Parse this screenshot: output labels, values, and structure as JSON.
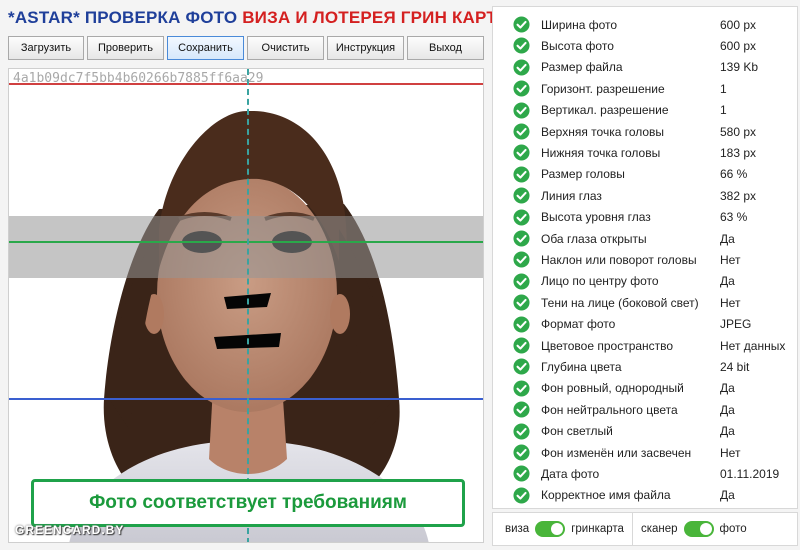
{
  "title": {
    "part1": "*ASTAR* ПРОВЕРКА ФОТО",
    "part2": "ВИЗА И ЛОТЕРЕЯ ГРИН КАРТА",
    "color1": "#1f3f9a",
    "color2": "#d42020"
  },
  "toolbar": {
    "buttons": [
      {
        "label": "Загрузить"
      },
      {
        "label": "Проверить"
      },
      {
        "label": "Сохранить"
      },
      {
        "label": "Очистить"
      },
      {
        "label": "Инструкция"
      },
      {
        "label": "Выход"
      }
    ]
  },
  "photo": {
    "hash": "4a1b09dc7f5bb4b60266b7885ff6aa29",
    "status_text": "Фото соответствует требованиям",
    "watermark": "GREENCARD.BY",
    "line_colors": {
      "top": "#d04040",
      "eyes": "#2aa84a",
      "bottom": "#3a5fd0",
      "center": "#3aa3a0"
    }
  },
  "checks": [
    {
      "label": "Ширина фото",
      "value": "600 px"
    },
    {
      "label": "Высота фото",
      "value": "600 px"
    },
    {
      "label": "Размер файла",
      "value": "139 Kb"
    },
    {
      "label": "Горизонт. разрешение",
      "value": "1"
    },
    {
      "label": "Вертикал. разрешение",
      "value": "1"
    },
    {
      "label": "Верхняя точка головы",
      "value": "580 px"
    },
    {
      "label": "Нижняя точка головы",
      "value": "183 px"
    },
    {
      "label": "Размер головы",
      "value": "66 %"
    },
    {
      "label": "Линия глаз",
      "value": "382 px"
    },
    {
      "label": "Высота уровня глаз",
      "value": "63 %"
    },
    {
      "label": "Оба глаза открыты",
      "value": "Да"
    },
    {
      "label": "Наклон или поворот головы",
      "value": "Нет"
    },
    {
      "label": "Лицо по центру фото",
      "value": "Да"
    },
    {
      "label": "Тени на лице (боковой свет)",
      "value": "Нет"
    },
    {
      "label": "Формат фото",
      "value": "JPEG"
    },
    {
      "label": "Цветовое пространство",
      "value": "Нет данных"
    },
    {
      "label": "Глубина цвета",
      "value": "24 bit"
    },
    {
      "label": "Фон ровный, однородный",
      "value": "Да"
    },
    {
      "label": "Фон нейтрального цвета",
      "value": "Да"
    },
    {
      "label": "Фон светлый",
      "value": "Да"
    },
    {
      "label": "Фон изменён или засвечен",
      "value": "Нет"
    },
    {
      "label": "Дата фото",
      "value": "01.11.2019"
    },
    {
      "label": "Корректное имя файла",
      "value": "Да"
    }
  ],
  "check_icon": {
    "name": "check-circle-icon",
    "color": "#2ea84a"
  },
  "toggles": {
    "left_off": "виза",
    "left_on": "гринкарта",
    "right_off": "сканер",
    "right_on": "фото",
    "on_color": "#49b53a"
  }
}
